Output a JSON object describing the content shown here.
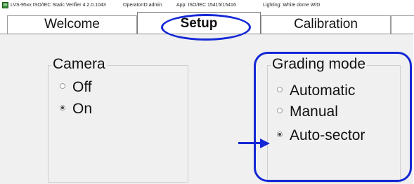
{
  "titlebar": {
    "app_title": "LVS-95xx ISO/IEC Static Verifier 4.2.0.1043",
    "operator": "OperatorID:admin",
    "app": "App: ISO/IEC 15415/15416",
    "lighting": "Lighting: White dome W/D"
  },
  "tabs": [
    {
      "label": "Welcome",
      "active": false
    },
    {
      "label": "Setup",
      "active": true
    },
    {
      "label": "Calibration",
      "active": false
    }
  ],
  "camera": {
    "title": "Camera",
    "options": [
      {
        "label": "Off",
        "checked": false
      },
      {
        "label": "On",
        "checked": true
      }
    ]
  },
  "grading_mode": {
    "title": "Grading mode",
    "options": [
      {
        "label": "Automatic",
        "checked": false
      },
      {
        "label": "Manual",
        "checked": false
      },
      {
        "label": "Auto-sector",
        "checked": true
      }
    ]
  },
  "annotation_color": "#1428d6"
}
